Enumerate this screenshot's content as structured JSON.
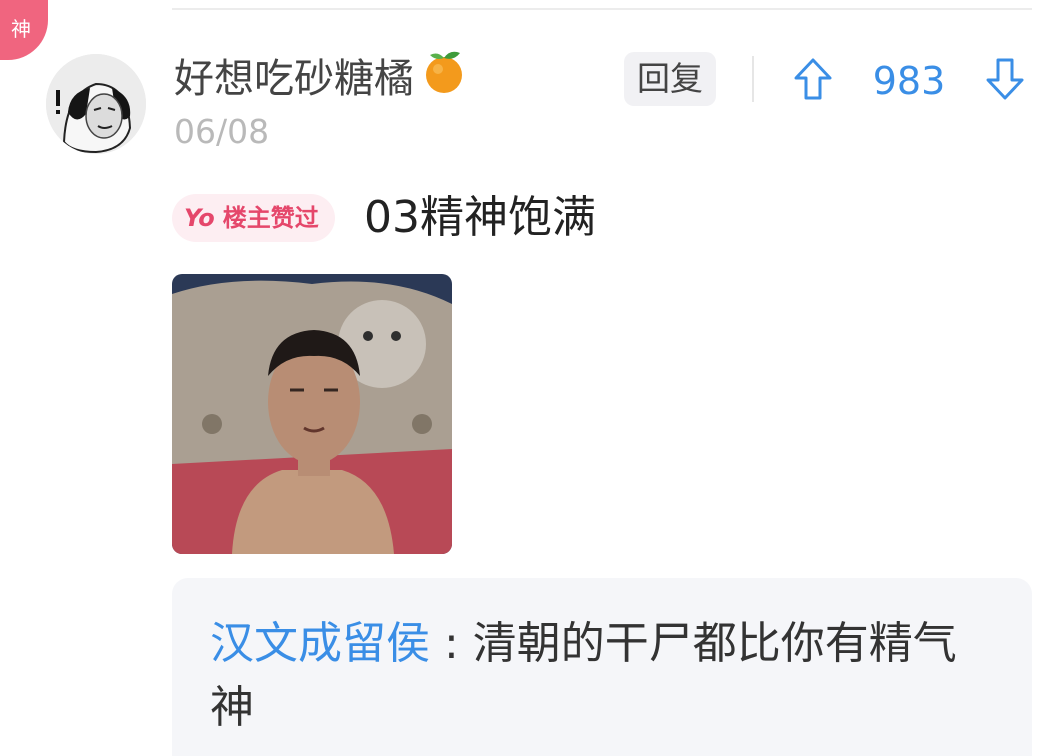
{
  "badge": {
    "label": "神"
  },
  "user": {
    "name": "好想吃砂糖橘",
    "emoji_icon": "tangerine-icon",
    "date": "06/08"
  },
  "actions": {
    "reply_label": "回复",
    "upvote_icon": "arrow-up-outline-icon",
    "vote_count": "983",
    "downvote_icon": "arrow-down-outline-icon"
  },
  "comment": {
    "badge_yo": "Yo",
    "badge_text": "楼主赞过",
    "text": "03精神饱满"
  },
  "reply": {
    "author": "汉文成留侯",
    "separator": " : ",
    "text": "清朝的干尸都比你有精气神"
  },
  "colors": {
    "accent_blue": "#3a8ee6",
    "badge_pink": "#f0657f",
    "liked_pink": "#e5476b"
  }
}
